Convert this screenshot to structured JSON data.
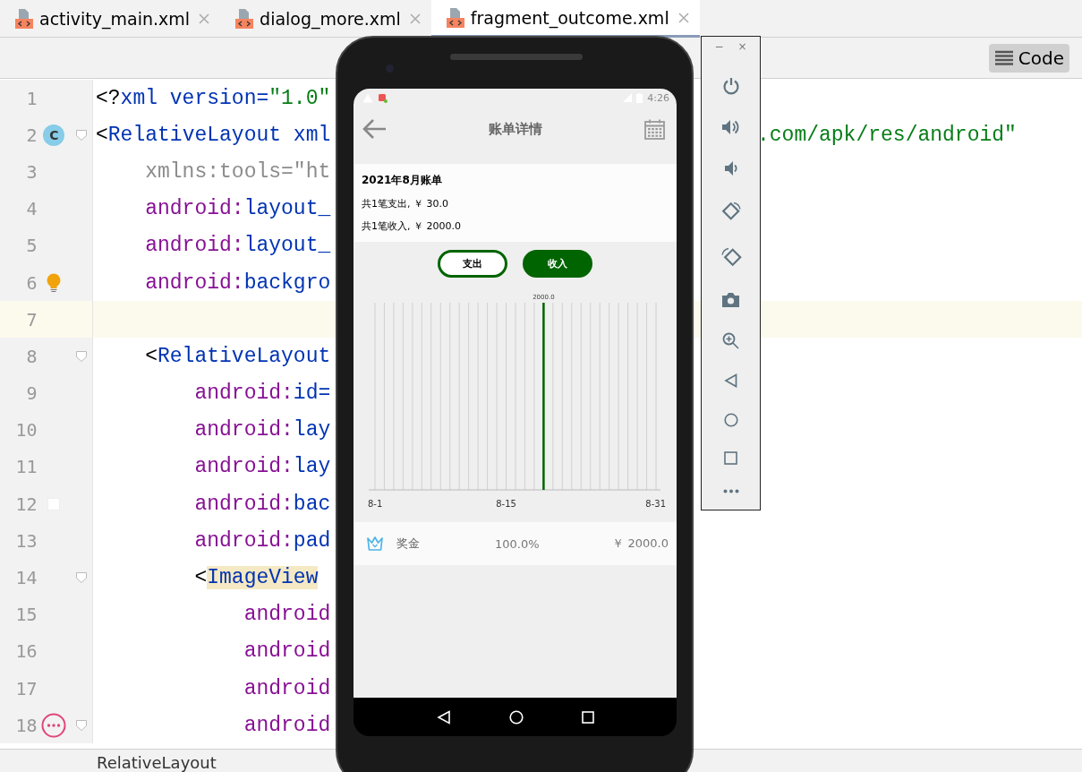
{
  "tabs": [
    {
      "label": "activity_main.xml",
      "selected": false
    },
    {
      "label": "dialog_more.xml",
      "selected": false
    },
    {
      "label": "fragment_outcome.xml",
      "selected": true
    }
  ],
  "toolbar": {
    "view_button": {
      "label": "Code",
      "selected": true
    }
  },
  "editor": {
    "lines": [
      {
        "number": "1",
        "current": false,
        "fold": false,
        "left": [
          {
            "t": "<?",
            "kind": "punct"
          },
          {
            "t": "xml version=",
            "kind": "tag"
          },
          {
            "t": "\"1.0\"",
            "kind": "str"
          }
        ]
      },
      {
        "number": "2",
        "current": false,
        "fold": true,
        "marker": {
          "kind": "class",
          "text": "C"
        },
        "left": [
          {
            "t": "<",
            "kind": "punct"
          },
          {
            "t": "RelativeLayout xml",
            "kind": "tag"
          }
        ],
        "right": [
          {
            "t": ".com/apk/res/android\"",
            "kind": "str"
          }
        ]
      },
      {
        "number": "3",
        "current": false,
        "fold": false,
        "left": [
          {
            "t": "    xmlns:tools=\"ht",
            "kind": "ns"
          }
        ]
      },
      {
        "number": "4",
        "current": false,
        "fold": false,
        "left": [
          {
            "t": "    android:",
            "kind": "attr"
          },
          {
            "t": "layout_",
            "kind": "tag"
          }
        ]
      },
      {
        "number": "5",
        "current": false,
        "fold": false,
        "left": [
          {
            "t": "    android:",
            "kind": "attr"
          },
          {
            "t": "layout_",
            "kind": "tag"
          }
        ]
      },
      {
        "number": "6",
        "current": false,
        "fold": false,
        "marker": {
          "kind": "bulb"
        },
        "left": [
          {
            "t": "    android:",
            "kind": "attr"
          },
          {
            "t": "backgro",
            "kind": "tag"
          }
        ]
      },
      {
        "number": "7",
        "current": true,
        "fold": false
      },
      {
        "number": "8",
        "current": false,
        "fold": true,
        "left": [
          {
            "t": "    <",
            "kind": "punct"
          },
          {
            "t": "RelativeLayout",
            "kind": "tag"
          }
        ]
      },
      {
        "number": "9",
        "current": false,
        "fold": false,
        "left": [
          {
            "t": "        android:",
            "kind": "attr"
          },
          {
            "t": "id=",
            "kind": "tag"
          }
        ]
      },
      {
        "number": "10",
        "current": false,
        "fold": false,
        "left": [
          {
            "t": "        android:",
            "kind": "attr"
          },
          {
            "t": "lay",
            "kind": "tag"
          }
        ]
      },
      {
        "number": "11",
        "current": false,
        "fold": false,
        "left": [
          {
            "t": "        android:",
            "kind": "attr"
          },
          {
            "t": "lay",
            "kind": "tag"
          }
        ]
      },
      {
        "number": "12",
        "current": false,
        "fold": false,
        "marker": {
          "kind": "swatch"
        },
        "left": [
          {
            "t": "        android:",
            "kind": "attr"
          },
          {
            "t": "bac",
            "kind": "tag"
          }
        ]
      },
      {
        "number": "13",
        "current": false,
        "fold": false,
        "left": [
          {
            "t": "        android:",
            "kind": "attr"
          },
          {
            "t": "pad",
            "kind": "tag"
          }
        ]
      },
      {
        "number": "14",
        "current": false,
        "fold": true,
        "left": [
          {
            "t": "        <",
            "kind": "punct"
          },
          {
            "t": "ImageView",
            "kind": "match"
          }
        ]
      },
      {
        "number": "15",
        "current": false,
        "fold": false,
        "left": [
          {
            "t": "            android",
            "kind": "attr"
          }
        ]
      },
      {
        "number": "16",
        "current": false,
        "fold": false,
        "left": [
          {
            "t": "            android",
            "kind": "attr"
          }
        ]
      },
      {
        "number": "17",
        "current": false,
        "fold": false,
        "left": [
          {
            "t": "            android",
            "kind": "attr"
          }
        ]
      },
      {
        "number": "18",
        "current": false,
        "fold": true,
        "marker": {
          "kind": "dots"
        },
        "left": [
          {
            "t": "            android",
            "kind": "attr"
          }
        ]
      }
    ]
  },
  "status_bar": {
    "breadcrumb": "RelativeLayout"
  },
  "emulator_panel": {
    "minimize": "−",
    "close": "×"
  },
  "phone": {
    "status_time": "4:26",
    "app_bar": {
      "title": "账单详情"
    },
    "summary": {
      "title": "2021年8月账单",
      "lines": [
        "共1笔支出, ￥ 30.0",
        "共1笔收入, ￥ 2000.0"
      ]
    },
    "toggle": [
      {
        "label": "支出",
        "selected": false
      },
      {
        "label": "收入",
        "selected": true
      }
    ],
    "chart_data": {
      "type": "bar",
      "categories": [
        "8-1",
        null,
        null,
        null,
        null,
        null,
        null,
        null,
        null,
        null,
        null,
        null,
        null,
        null,
        "8-15",
        null,
        null,
        null,
        null,
        null,
        null,
        null,
        null,
        null,
        null,
        null,
        null,
        null,
        null,
        null,
        "8-31"
      ],
      "grid": true,
      "ylim": [
        0,
        2000
      ],
      "series": [
        {
          "color": "#006400",
          "values": [
            null,
            null,
            null,
            null,
            null,
            null,
            null,
            null,
            null,
            null,
            null,
            null,
            null,
            null,
            null,
            null,
            null,
            null,
            2000,
            null,
            null,
            null,
            null,
            null,
            null,
            null,
            null,
            null,
            null,
            null,
            null
          ],
          "value_labels": [
            null,
            null,
            null,
            null,
            null,
            null,
            null,
            null,
            null,
            null,
            null,
            null,
            null,
            null,
            null,
            null,
            null,
            null,
            "2000.0",
            null,
            null,
            null,
            null,
            null,
            null,
            null,
            null,
            null,
            null,
            null,
            null
          ]
        }
      ]
    },
    "categories": [
      {
        "name": "奖金",
        "share": "100.0%",
        "amount": "￥ 2000.0"
      }
    ]
  }
}
